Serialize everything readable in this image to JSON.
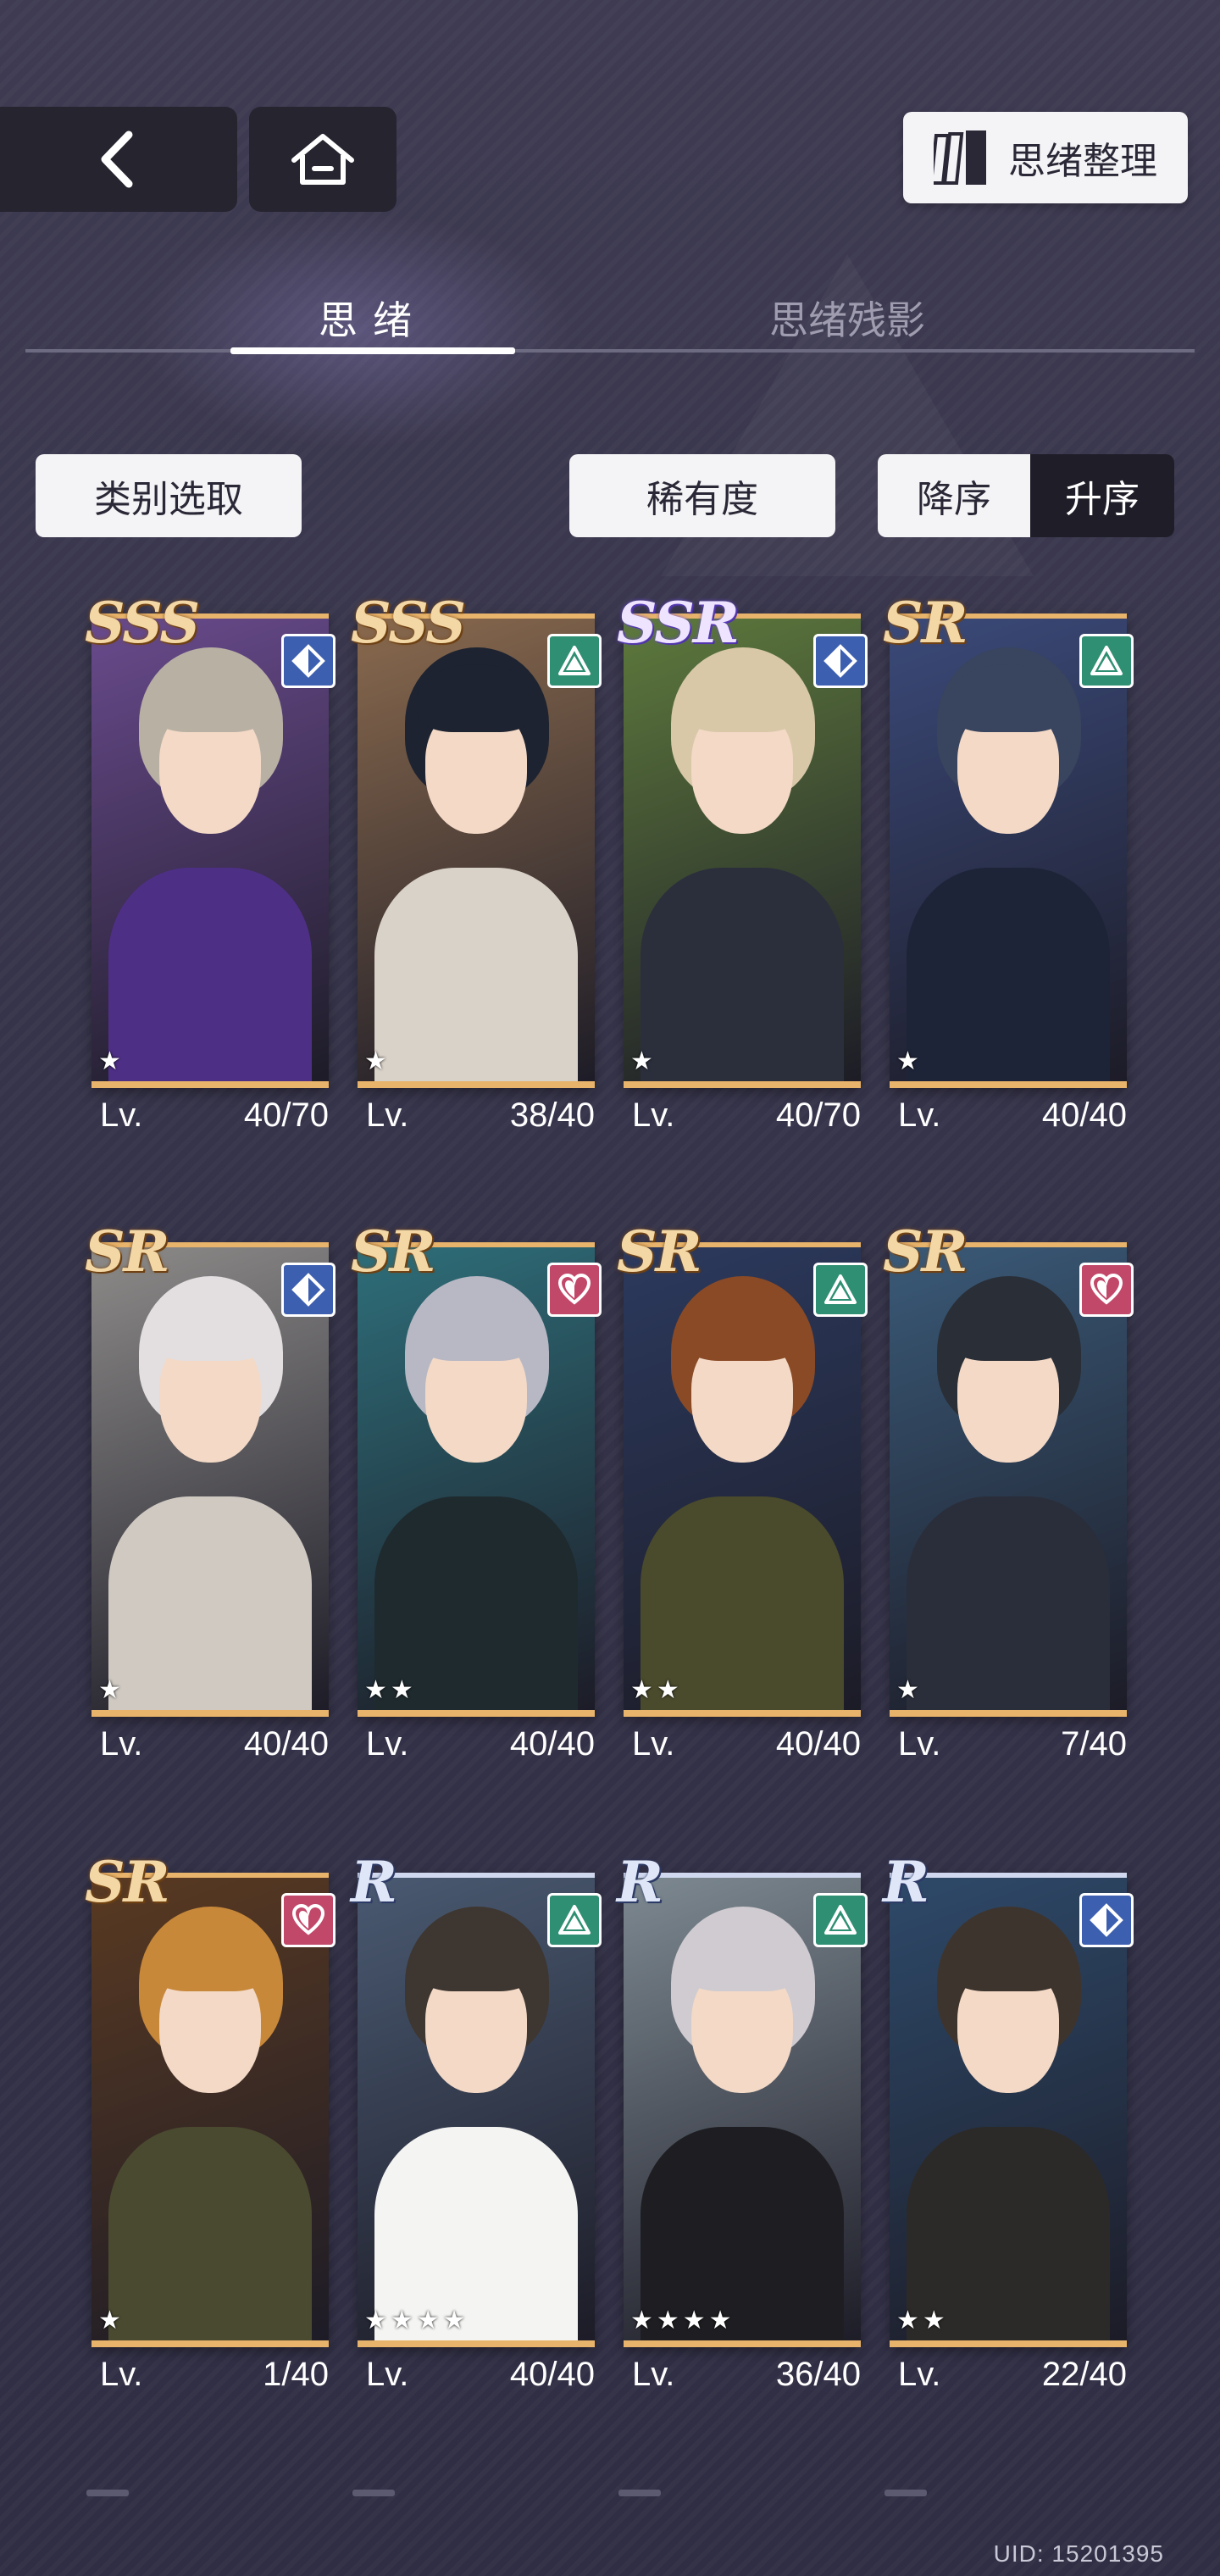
{
  "nav": {
    "organize_label": "思绪整理"
  },
  "tabs": {
    "active": "思绪",
    "inactive": "思绪残影"
  },
  "filters": {
    "category": "类别选取",
    "rarity": "稀有度",
    "sort_desc": "降序",
    "sort_asc": "升序"
  },
  "lv_label": "Lv.",
  "cards": [
    {
      "rarity": "SSS",
      "type": "diamond",
      "type_color": "#3d5fb0",
      "stars": "★",
      "level": "40/70",
      "bg": "#6a4b8e",
      "hair": "#b9b0a4",
      "body": "#4e2f86"
    },
    {
      "rarity": "SSS",
      "type": "triangle",
      "type_color": "#2f8f73",
      "stars": "★",
      "level": "38/40",
      "bg": "#8a6a4e",
      "hair": "#1d2330",
      "body": "#d9d2c8"
    },
    {
      "rarity": "SSR",
      "type": "diamond",
      "type_color": "#3d5fb0",
      "stars": "★",
      "level": "40/70",
      "bg": "#5e7a3d",
      "hair": "#d8c8a8",
      "body": "#2b2f3c"
    },
    {
      "rarity": "SR",
      "type": "triangle",
      "type_color": "#2f8f73",
      "stars": "★",
      "level": "40/40",
      "bg": "#3b4a7a",
      "hair": "#39445e",
      "body": "#1e2438"
    },
    {
      "rarity": "SR",
      "type": "diamond",
      "type_color": "#3d5fb0",
      "stars": "★",
      "level": "40/40",
      "bg": "#8e8c8a",
      "hair": "#e3dfe0",
      "body": "#cfc9c2"
    },
    {
      "rarity": "SR",
      "type": "heart",
      "type_color": "#c2486a",
      "stars": "★★",
      "level": "40/40",
      "bg": "#2e6f7a",
      "hair": "#b8b8c4",
      "body": "#1f2a2e"
    },
    {
      "rarity": "SR",
      "type": "triangle",
      "type_color": "#2f8f73",
      "stars": "★★",
      "level": "40/40",
      "bg": "#2c3a5e",
      "hair": "#8a4a26",
      "body": "#4a4a2c"
    },
    {
      "rarity": "SR",
      "type": "heart",
      "type_color": "#c2486a",
      "stars": "★",
      "level": "7/40",
      "bg": "#3a5a78",
      "hair": "#2a2e36",
      "body": "#2a2e3a"
    },
    {
      "rarity": "SR",
      "type": "heart",
      "type_color": "#c2486a",
      "stars": "★",
      "level": "1/40",
      "bg": "#5a3a22",
      "hair": "#c8883a",
      "body": "#4a4a30"
    },
    {
      "rarity": "R",
      "type": "triangle",
      "type_color": "#2f8f73",
      "stars": "★★★★",
      "level": "40/40",
      "bg": "#4a5a72",
      "hair": "#3e3630",
      "body": "#f4f4f2"
    },
    {
      "rarity": "R",
      "type": "triangle",
      "type_color": "#2f8f73",
      "stars": "★★★★",
      "level": "36/40",
      "bg": "#7e8a92",
      "hair": "#cfcbd0",
      "body": "#1e1e22"
    },
    {
      "rarity": "R",
      "type": "diamond",
      "type_color": "#3d5fb0",
      "stars": "★★",
      "level": "22/40",
      "bg": "#2e4a6a",
      "hair": "#3e342e",
      "body": "#2c2a28"
    }
  ],
  "uid": "UID: 15201395"
}
